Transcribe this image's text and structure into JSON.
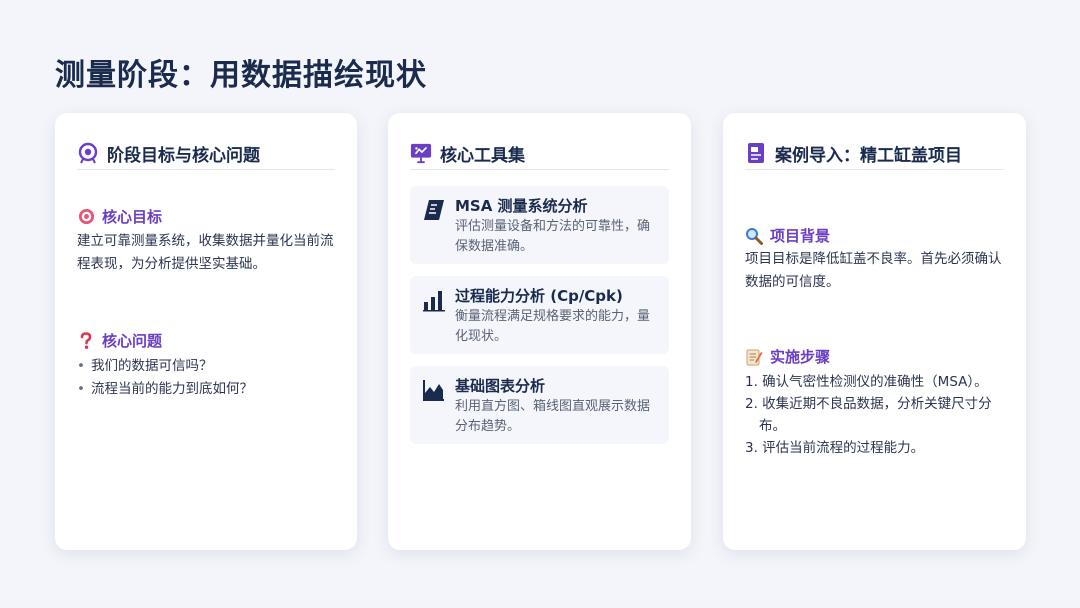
{
  "page": {
    "title": "测量阶段：用数据描绘现状"
  },
  "card1": {
    "title": "阶段目标与核心问题",
    "goal": {
      "title": "核心目标",
      "text": "建立可靠测量系统，收集数据并量化当前流程表现，为分析提供坚实基础。"
    },
    "questions": {
      "title": "核心问题",
      "items": [
        "我们的数据可信吗？",
        "流程当前的能力到底如何？"
      ]
    }
  },
  "card2": {
    "title": "核心工具集",
    "tools": [
      {
        "name": "MSA 测量系统分析",
        "desc": "评估测量设备和方法的可靠性，确保数据准确。"
      },
      {
        "name": "过程能力分析 (Cp/Cpk)",
        "desc": "衡量流程满足规格要求的能力，量化现状。"
      },
      {
        "name": "基础图表分析",
        "desc": "利用直方图、箱线图直观展示数据分布趋势。"
      }
    ]
  },
  "card3": {
    "title": "案例导入：精工缸盖项目",
    "background": {
      "title": "项目背景",
      "text": "项目目标是降低缸盖不良率。首先必须确认数据的可信度。"
    },
    "steps": {
      "title": "实施步骤",
      "items": [
        "1. 确认气密性检测仪的准确性（MSA）。",
        "2. 收集近期不良品数据，分析关键尺寸分布。",
        "3. 评估当前流程的过程能力。"
      ]
    }
  },
  "colors": {
    "accent": "#6a3fc4",
    "title": "#1a2b4e",
    "background": "#f3f5fa"
  }
}
